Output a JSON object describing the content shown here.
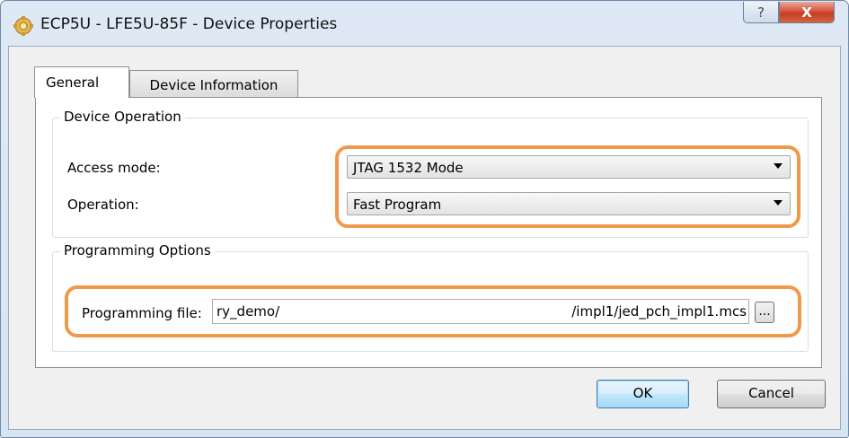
{
  "window": {
    "title": "ECP5U - LFE5U-85F - Device Properties",
    "help_glyph": "?",
    "close_glyph": "X"
  },
  "tabs": [
    {
      "label": "General",
      "active": true
    },
    {
      "label": "Device Information",
      "active": false
    }
  ],
  "device_operation": {
    "title": "Device Operation",
    "access_mode_label": "Access mode:",
    "access_mode_value": "JTAG 1532 Mode",
    "operation_label": "Operation:",
    "operation_value": "Fast Program"
  },
  "programming_options": {
    "title": "Programming Options",
    "file_label": "Programming file:",
    "file_value_start": "ry_demo/",
    "file_value_end": "/impl1/jed_pch_impl1.mcs",
    "browse_label": "..."
  },
  "buttons": {
    "ok": "OK",
    "cancel": "Cancel"
  },
  "colors": {
    "highlight": "#ef9a4b",
    "default_button": "#bee6fd",
    "close_button": "#c23d25"
  },
  "icons": {
    "app": "chip-gear-icon",
    "dropdown": "chevron-down-icon"
  }
}
